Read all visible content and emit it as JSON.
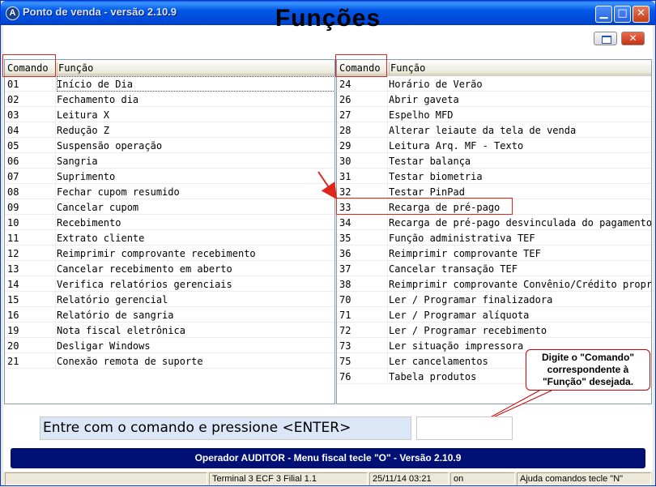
{
  "window": {
    "title": "Ponto de venda - versão 2.10.9",
    "app_icon_letter": "A",
    "buttons": {
      "minimize": "▁",
      "maximize": "□",
      "close": "✕"
    }
  },
  "heading": "Funções",
  "columns": {
    "command": "Comando",
    "function": "Função"
  },
  "left_list": [
    {
      "cmd": "01",
      "func": "Início de Dia"
    },
    {
      "cmd": "02",
      "func": "Fechamento dia"
    },
    {
      "cmd": "03",
      "func": "Leitura X"
    },
    {
      "cmd": "04",
      "func": "Redução Z"
    },
    {
      "cmd": "05",
      "func": "Suspensão operação"
    },
    {
      "cmd": "06",
      "func": "Sangria"
    },
    {
      "cmd": "07",
      "func": "Suprimento"
    },
    {
      "cmd": "08",
      "func": "Fechar cupom resumido"
    },
    {
      "cmd": "09",
      "func": "Cancelar cupom"
    },
    {
      "cmd": "10",
      "func": "Recebimento"
    },
    {
      "cmd": "11",
      "func": "Extrato cliente"
    },
    {
      "cmd": "12",
      "func": "Reimprimir comprovante recebimento"
    },
    {
      "cmd": "13",
      "func": "Cancelar recebimento em aberto"
    },
    {
      "cmd": "14",
      "func": "Verifica relatórios gerenciais"
    },
    {
      "cmd": "15",
      "func": "Relatório gerencial"
    },
    {
      "cmd": "16",
      "func": "Relatório de sangria"
    },
    {
      "cmd": "19",
      "func": "Nota fiscal eletrônica"
    },
    {
      "cmd": "20",
      "func": "Desligar Windows"
    },
    {
      "cmd": "21",
      "func": "Conexão remota de suporte"
    }
  ],
  "right_list": [
    {
      "cmd": "24",
      "func": "Horário de Verão"
    },
    {
      "cmd": "26",
      "func": "Abrir gaveta"
    },
    {
      "cmd": "27",
      "func": "Espelho MFD"
    },
    {
      "cmd": "28",
      "func": "Alterar leiaute da tela de venda"
    },
    {
      "cmd": "29",
      "func": "Leitura Arq. MF - Texto"
    },
    {
      "cmd": "30",
      "func": "Testar balança"
    },
    {
      "cmd": "31",
      "func": "Testar biometria"
    },
    {
      "cmd": "32",
      "func": "Testar PinPad"
    },
    {
      "cmd": "33",
      "func": "Recarga de pré-pago"
    },
    {
      "cmd": "34",
      "func": "Recarga de pré-pago desvinculada do pagamento"
    },
    {
      "cmd": "35",
      "func": "Função administrativa TEF"
    },
    {
      "cmd": "36",
      "func": "Reimprimir comprovante TEF"
    },
    {
      "cmd": "37",
      "func": "Cancelar transação TEF"
    },
    {
      "cmd": "38",
      "func": "Reimprimir comprovante Convênio/Crédito proprio"
    },
    {
      "cmd": "70",
      "func": "Ler / Programar finalizadora"
    },
    {
      "cmd": "71",
      "func": "Ler / Programar alíquota"
    },
    {
      "cmd": "72",
      "func": "Ler / Programar recebimento"
    },
    {
      "cmd": "73",
      "func": "Ler situação impressora"
    },
    {
      "cmd": "75",
      "func": "Ler cancelamentos"
    },
    {
      "cmd": "76",
      "func": "Tabela produtos"
    }
  ],
  "callout": {
    "line1": "Digite o \"Comando\"",
    "line2": "correspondente à",
    "line3": "\"Função\" desejada."
  },
  "command_prompt": "Entre com o comando e pressione <ENTER>",
  "command_value": "",
  "operator_bar": "Operador AUDITOR - Menu fiscal tecle \"O\" - Versão 2.10.9",
  "status": [
    "",
    "Terminal 3 ECF 3 Filial 1.1",
    "25/11/14 03:21",
    "on",
    "Ajuda comandos tecle \"N\""
  ],
  "colors": {
    "title_bar": "#0058e6",
    "operator_bar": "#001074",
    "highlight": "#e0261a",
    "prompt_bg": "#dbe6f6"
  }
}
